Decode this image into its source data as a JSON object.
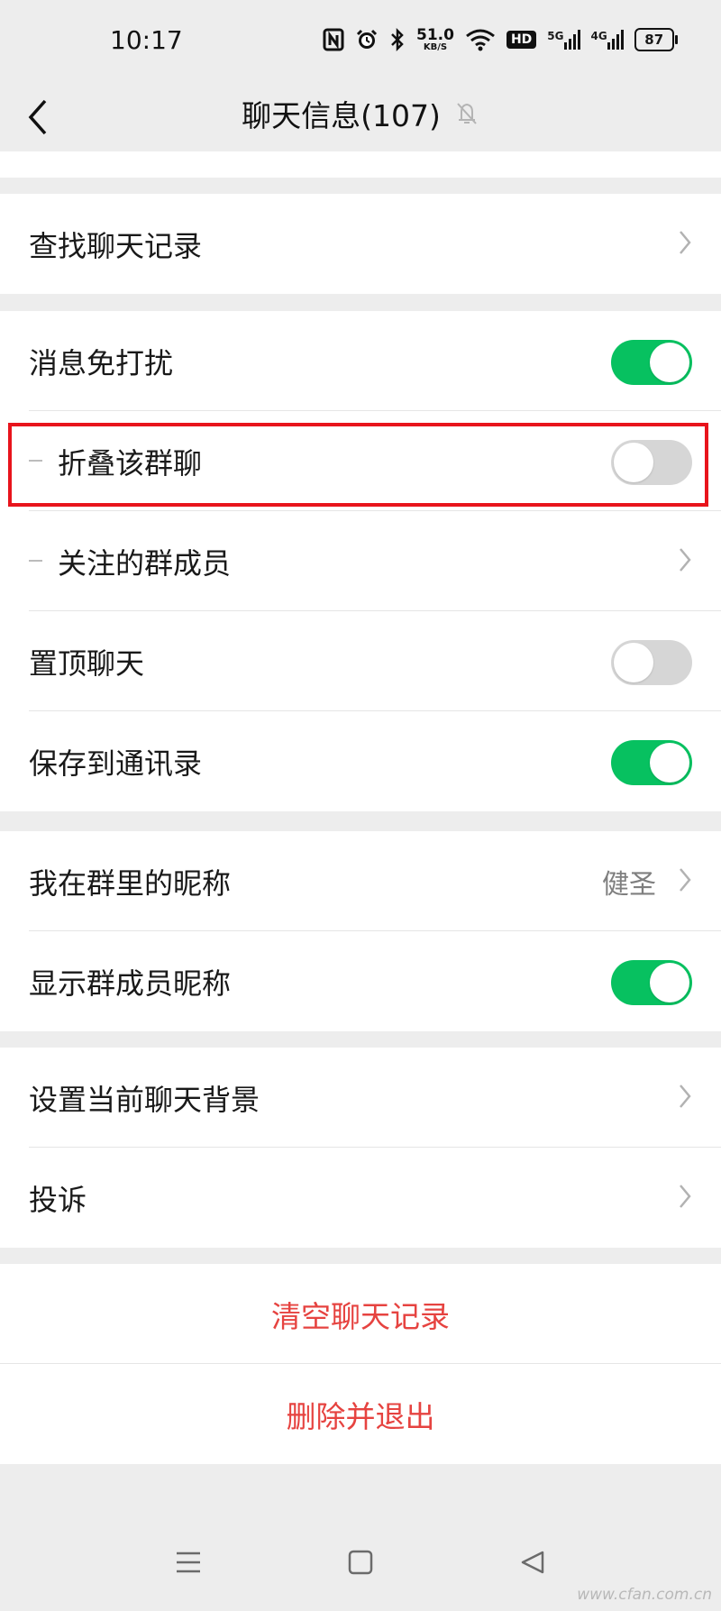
{
  "status_bar": {
    "time": "10:17",
    "net_speed_value": "51.0",
    "net_speed_unit": "KB/S",
    "hd_badge": "HD",
    "sig1": "5G",
    "sig2": "4G",
    "battery": "87"
  },
  "navbar": {
    "title": "聊天信息(107)"
  },
  "search_group": {
    "items": [
      {
        "label": "查找聊天记录"
      }
    ]
  },
  "settings_group": {
    "items": [
      {
        "label": "消息免打扰",
        "toggle": "on"
      },
      {
        "label": "折叠该群聊",
        "toggle": "off"
      },
      {
        "label": "关注的群成员"
      },
      {
        "label": "置顶聊天",
        "toggle": "off"
      },
      {
        "label": "保存到通讯录",
        "toggle": "on"
      }
    ]
  },
  "nickname_group": {
    "items": [
      {
        "label": "我在群里的昵称",
        "value": "健圣"
      },
      {
        "label": "显示群成员昵称",
        "toggle": "on"
      }
    ]
  },
  "misc_group": {
    "items": [
      {
        "label": "设置当前聊天背景"
      },
      {
        "label": "投诉"
      }
    ]
  },
  "danger_group": {
    "items": [
      {
        "label": "清空聊天记录"
      },
      {
        "label": "删除并退出"
      }
    ]
  },
  "watermark": "www.cfan.com.cn",
  "colors": {
    "accent_green": "#07c160",
    "danger_red": "#e64340",
    "highlight_red": "#e8141c",
    "background": "#ededed"
  }
}
